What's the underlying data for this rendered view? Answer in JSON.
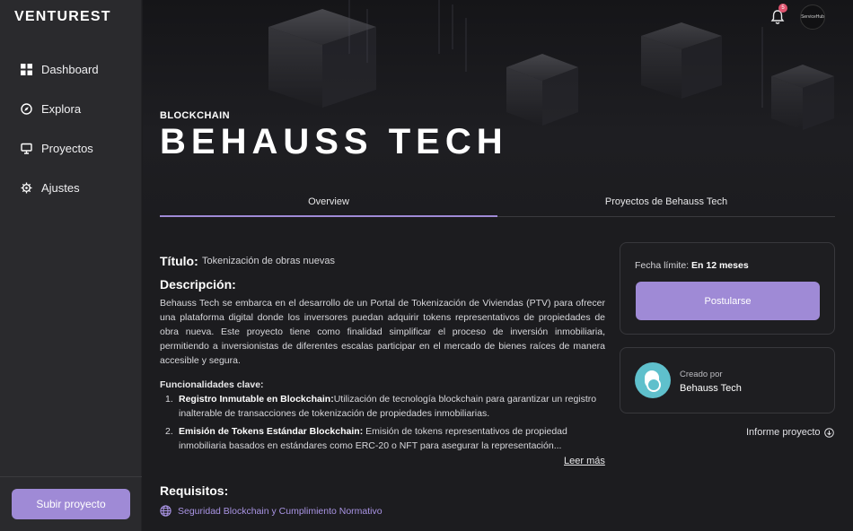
{
  "app": {
    "logo": "VENTUREST"
  },
  "sidebar": {
    "items": [
      {
        "label": "Dashboard",
        "icon": "grid-icon"
      },
      {
        "label": "Explora",
        "icon": "compass-icon"
      },
      {
        "label": "Proyectos",
        "icon": "monitor-icon"
      },
      {
        "label": "Ajustes",
        "icon": "gear-icon"
      }
    ],
    "upload_label": "Subir proyecto"
  },
  "topbar": {
    "notification_count": "5",
    "avatar_label": "ServiceHub"
  },
  "hero": {
    "category": "BLOCKCHAIN",
    "title": "BEHAUSS TECH"
  },
  "tabs": [
    {
      "label": "Overview",
      "active": true
    },
    {
      "label": "Proyectos de Behauss Tech",
      "active": false
    }
  ],
  "main": {
    "title_label": "Título:",
    "title_value": "Tokenización de obras nuevas",
    "description_heading": "Descripción:",
    "description": "Behauss Tech se embarca en el desarrollo de un Portal de Tokenización de Viviendas (PTV) para ofrecer una plataforma digital donde los inversores puedan adquirir tokens representativos de propiedades de obra nueva. Este proyecto tiene como finalidad simplificar el proceso de inversión inmobiliaria, permitiendo a inversionistas de diferentes escalas participar en el mercado de bienes raíces de manera accesible y segura.",
    "features_heading": "Funcionalidades clave:",
    "features": [
      {
        "num": "1.",
        "title": "Registro Inmutable en Blockchain:",
        "text": "Utilización de tecnología blockchain para garantizar un registro inalterable de transacciones de tokenización de propiedades inmobiliarias."
      },
      {
        "num": "2.",
        "title": "Emisión de Tokens Estándar Blockchain:",
        "text": " Emisión de tokens representativos de propiedad inmobiliaria basados en estándares como ERC-20 o NFT para asegurar la representación..."
      }
    ],
    "read_more": "Leer más",
    "requirements_heading": "Requisitos:",
    "requirement": "Seguridad Blockchain y Cumplimiento Normativo"
  },
  "deadline_card": {
    "label": "Fecha límite:",
    "value": "En 12 meses",
    "apply_label": "Postularse"
  },
  "creator_card": {
    "label": "Creado por",
    "name": "Behauss Tech"
  },
  "report_label": "Informe proyecto",
  "colors": {
    "accent": "#9f8ad6",
    "background": "#1c1c1f",
    "sidebar": "#2a2a2d",
    "link": "#a994e4"
  }
}
